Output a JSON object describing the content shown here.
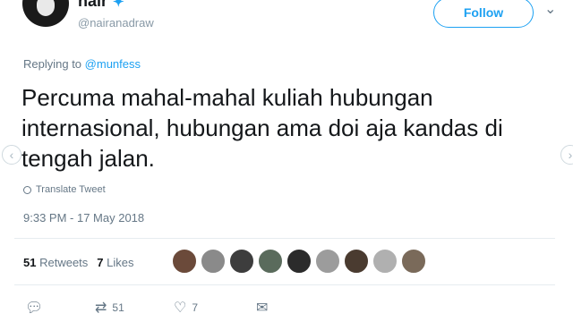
{
  "user": {
    "display_name": "nair",
    "handle": "@nairanadraw",
    "follow_label": "Follow"
  },
  "reply": {
    "prefix": "Replying to",
    "mention": "@munfess"
  },
  "tweet": {
    "text": "Percuma mahal-mahal kuliah hubungan internasional, hubungan ama doi aja kandas di tengah jalan.",
    "translate_label": "Translate Tweet",
    "timestamp": "9:33 PM - 17 May 2018"
  },
  "stats": {
    "retweets_count": "51",
    "retweets_label": "Retweets",
    "likes_count": "7",
    "likes_label": "Likes"
  },
  "actions": {
    "retweet_count": "51",
    "like_count": "7"
  },
  "likers": [
    {
      "color": "#6b4a3a"
    },
    {
      "color": "#8a8a8a"
    },
    {
      "color": "#3d3d3d"
    },
    {
      "color": "#5a6b5c"
    },
    {
      "color": "#2b2b2b"
    },
    {
      "color": "#9c9c9c"
    },
    {
      "color": "#4a3b30"
    },
    {
      "color": "#b0b0b0"
    },
    {
      "color": "#7a6a5a"
    }
  ],
  "colors": {
    "accent": "#1da1f2",
    "muted": "#657786",
    "text": "#14171a"
  }
}
